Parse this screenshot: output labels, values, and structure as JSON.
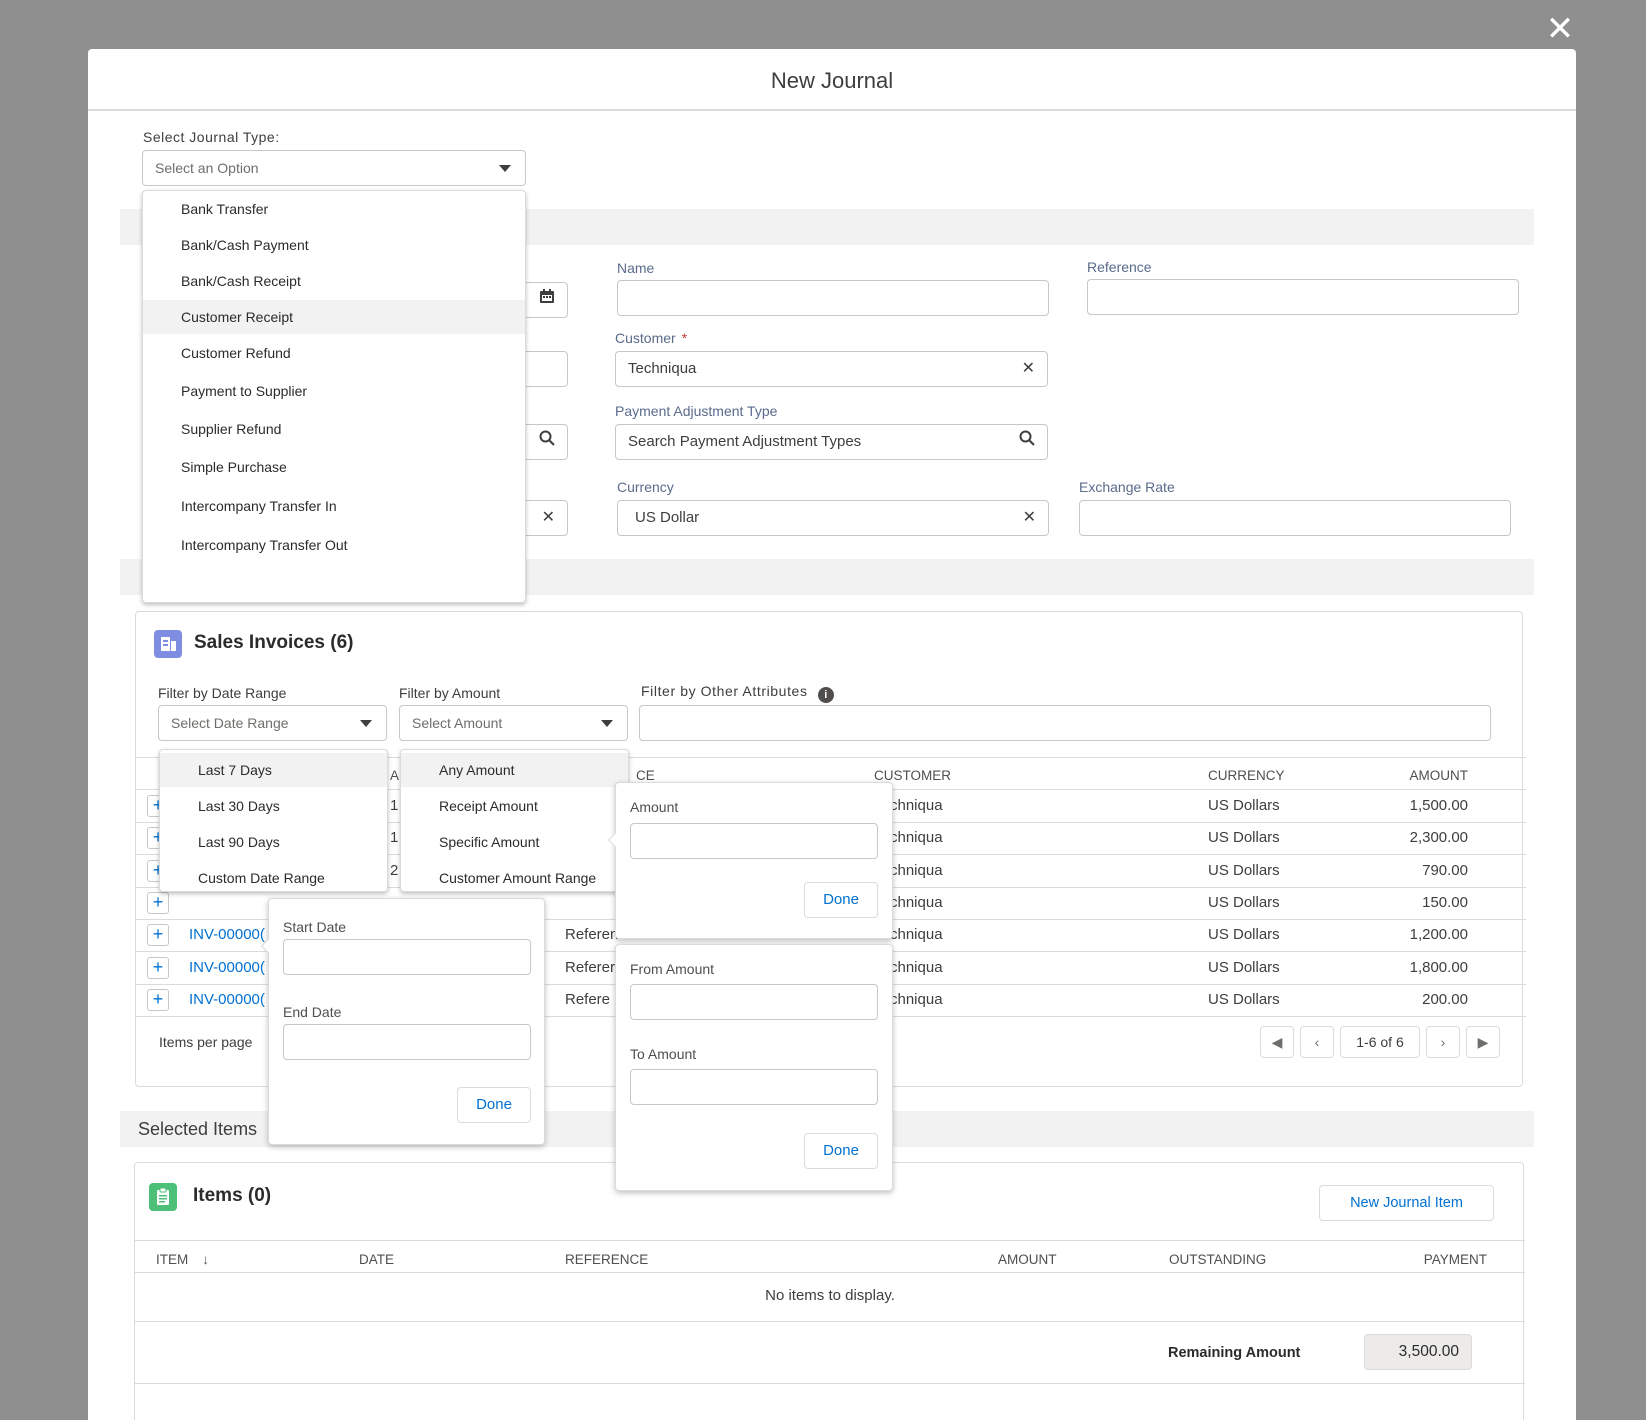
{
  "modal": {
    "title": "New Journal",
    "close_label": "✕"
  },
  "journal_type": {
    "label": "Select Journal Type:",
    "placeholder": "Select an Option",
    "options": [
      "Bank Transfer",
      "Bank/Cash Payment",
      "Bank/Cash Receipt",
      "Customer Receipt",
      "Customer Refund",
      "Payment to Supplier",
      "Supplier Refund",
      "Simple Purchase",
      "Intercompany Transfer In",
      "Intercompany Transfer Out"
    ],
    "highlighted": "Customer Receipt"
  },
  "form": {
    "name_label": "Name",
    "name_value": "",
    "reference_label": "Reference",
    "reference_value": "",
    "customer_label": "Customer",
    "customer_required": "*",
    "customer_value": "Techniqua",
    "adjustment_label": "Payment Adjustment Type",
    "adjustment_placeholder": "Search Payment Adjustment Types",
    "currency_label": "Currency",
    "currency_value": "US Dollar",
    "exchange_label": "Exchange Rate",
    "exchange_value": ""
  },
  "sales_invoices": {
    "title": "Sales Invoices (6)",
    "filter_date_label": "Filter by Date Range",
    "filter_date_placeholder": "Select Date Range",
    "filter_amount_label": "Filter by Amount",
    "filter_amount_placeholder": "Select Amount",
    "filter_other_label": "Filter by Other Attributes",
    "date_options": [
      "Last 7 Days",
      "Last 30 Days",
      "Last 90 Days",
      "Custom Date Range"
    ],
    "amount_options": [
      "Any Amount",
      "Receipt Amount",
      "Specific Amount",
      "Customer Amount Range"
    ],
    "headers": {
      "col2_fragment": "A",
      "col3_fragment": "CE",
      "customer": "CUSTOMER",
      "currency": "CURRENCY",
      "amount": "AMOUNT"
    },
    "rows": [
      {
        "invoice": "",
        "date_frag": "1",
        "ref": "",
        "customer": "chniqua",
        "currency": "US Dollars",
        "amount": "1,500.00"
      },
      {
        "invoice": "",
        "date_frag": "1",
        "ref": "",
        "customer": "chniqua",
        "currency": "US Dollars",
        "amount": "2,300.00"
      },
      {
        "invoice": "",
        "date_frag": "2",
        "ref": "",
        "customer": "chniqua",
        "currency": "US Dollars",
        "amount": "790.00"
      },
      {
        "invoice": "",
        "date_frag": "",
        "ref": "",
        "customer": "chniqua",
        "currency": "US Dollars",
        "amount": "150.00"
      },
      {
        "invoice": "INV-00000(",
        "date_frag": "",
        "ref": "Referen",
        "customer": "chniqua",
        "currency": "US Dollars",
        "amount": "1,200.00"
      },
      {
        "invoice": "INV-00000(",
        "date_frag": "",
        "ref": "Referer",
        "customer": "chniqua",
        "currency": "US Dollars",
        "amount": "1,800.00"
      },
      {
        "invoice": "INV-00000(",
        "date_frag": "",
        "ref": "Refere",
        "customer": "chniqua",
        "currency": "US Dollars",
        "amount": "200.00"
      }
    ],
    "items_per_page_label": "Items per page",
    "pager_text": "1-6 of 6"
  },
  "date_popover": {
    "start_label": "Start Date",
    "end_label": "End Date",
    "done_label": "Done"
  },
  "amount_popover": {
    "amount_label": "Amount",
    "done_label": "Done"
  },
  "range_popover": {
    "from_label": "From Amount",
    "to_label": "To Amount",
    "done_label": "Done"
  },
  "selected_items": {
    "band_label": "Selected  Items",
    "title": "Items (0)",
    "new_button": "New Journal Item",
    "headers": {
      "item": "ITEM",
      "date": "DATE",
      "reference": "REFERENCE",
      "amount": "AMOUNT",
      "outstanding": "OUTSTANDING",
      "payment": "PAYMENT"
    },
    "empty_text": "No items to display.",
    "remaining_label": "Remaining Amount",
    "remaining_value": "3,500.00"
  },
  "colors": {
    "accent": "#0070d2",
    "invoice_icon": "#7f8de1",
    "items_icon": "#4bc076"
  }
}
